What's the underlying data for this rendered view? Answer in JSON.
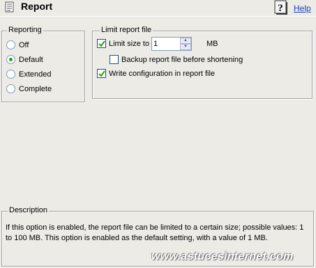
{
  "header": {
    "title": "Report",
    "help_label": "Help"
  },
  "reporting": {
    "legend": "Reporting",
    "options": [
      {
        "label": "Off",
        "checked": false
      },
      {
        "label": "Default",
        "checked": true
      },
      {
        "label": "Extended",
        "checked": false
      },
      {
        "label": "Complete",
        "checked": false
      }
    ]
  },
  "limit": {
    "legend": "Limit report file",
    "limit_size_label": "Limit size to",
    "limit_size_checked": true,
    "size_value": "1",
    "unit": "MB",
    "backup_label": "Backup report file before shortening",
    "backup_checked": false,
    "write_config_label": "Write configuration in report file",
    "write_config_checked": true
  },
  "description": {
    "legend": "Description",
    "text": "If this option is enabled, the report file can be limited to a certain size; possible values: 1 to 100 MB. This option is enabled as the default setting, with a value of 1 MB."
  },
  "watermark": "www.astucesinternet.com"
}
